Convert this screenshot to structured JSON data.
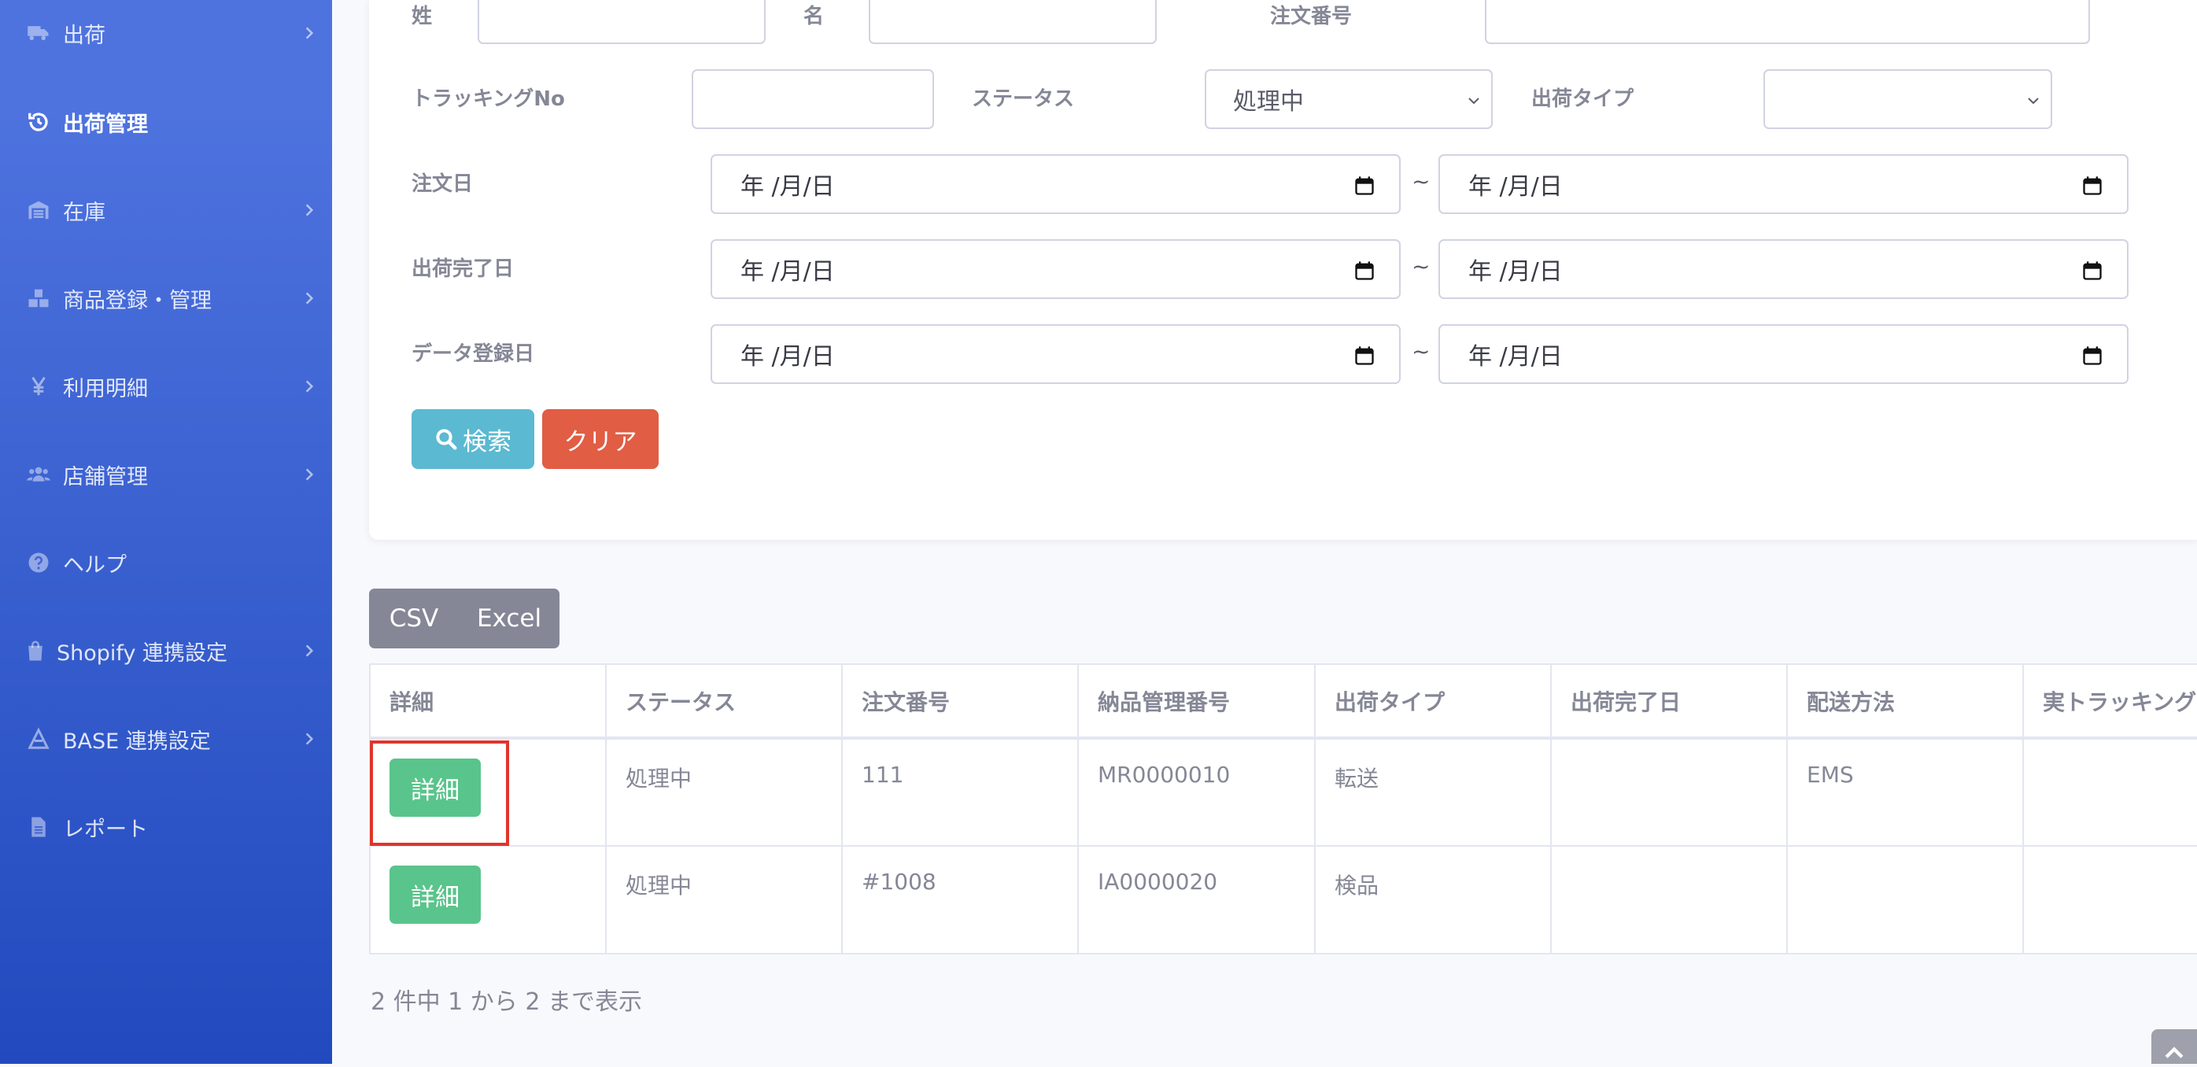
{
  "sidebar": {
    "items": [
      {
        "label": "出荷",
        "icon": "truck-icon",
        "active": false,
        "has_submenu": true
      },
      {
        "label": "出荷管理",
        "icon": "history-icon",
        "active": true,
        "has_submenu": false
      },
      {
        "label": "在庫",
        "icon": "warehouse-icon",
        "active": false,
        "has_submenu": true
      },
      {
        "label": "商品登録・管理",
        "icon": "boxes-icon",
        "active": false,
        "has_submenu": true
      },
      {
        "label": "利用明細",
        "icon": "yen-icon",
        "active": false,
        "has_submenu": true
      },
      {
        "label": "店舗管理",
        "icon": "users-icon",
        "active": false,
        "has_submenu": true
      },
      {
        "label": "ヘルプ",
        "icon": "question-circle-icon",
        "active": false,
        "has_submenu": false
      },
      {
        "label": "Shopify 連携設定",
        "icon": "shopping-bag-icon",
        "active": false,
        "has_submenu": true
      },
      {
        "label": "BASE 連携設定",
        "icon": "base-logo-icon",
        "active": false,
        "has_submenu": true
      },
      {
        "label": "レポート",
        "icon": "file-icon",
        "active": false,
        "has_submenu": false
      }
    ]
  },
  "search": {
    "last_name_label": "姓",
    "first_name_label": "名",
    "order_number_label": "注文番号",
    "tracking_label": "トラッキングNo",
    "status_label": "ステータス",
    "status_value": "処理中",
    "shipment_type_label": "出荷タイプ",
    "shipment_type_value": "",
    "order_date_label": "注文日",
    "shipped_date_label": "出荷完了日",
    "registered_date_label": "データ登録日",
    "date_placeholder": "年 /月/日",
    "range_separator": "~",
    "search_button": "検索",
    "clear_button": "クリア"
  },
  "export": {
    "csv": "CSV",
    "excel": "Excel"
  },
  "table": {
    "columns": [
      "詳細",
      "ステータス",
      "注文番号",
      "納品管理番号",
      "出荷タイプ",
      "出荷完了日",
      "配送方法",
      "実トラッキング"
    ],
    "rows": [
      {
        "detail": "詳細",
        "status": "処理中",
        "order_no": "111",
        "delivery_no": "MR0000010",
        "type": "転送",
        "shipped_date": "",
        "method": "EMS",
        "tracking": ""
      },
      {
        "detail": "詳細",
        "status": "処理中",
        "order_no": "#1008",
        "delivery_no": "IA0000020",
        "type": "検品",
        "shipped_date": "",
        "method": "",
        "tracking": ""
      }
    ],
    "info": "2 件中 1 から 2 まで表示"
  }
}
